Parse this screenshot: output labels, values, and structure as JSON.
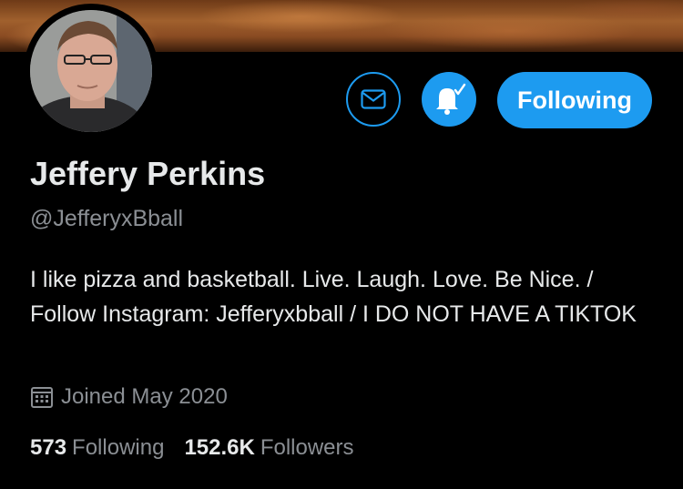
{
  "profile": {
    "name": "Jeffery Perkins",
    "handle": "@JefferyxBball",
    "bio": "I like pizza and basketball. Live. Laugh. Love. Be Nice. / Follow Instagram: Jefferyxbball / I DO NOT HAVE A TIKTOK",
    "joined": "Joined May 2020"
  },
  "actions": {
    "message_icon": "envelope-icon",
    "notify_icon": "bell-check-icon",
    "following_label": "Following"
  },
  "stats": {
    "following_count": "573",
    "following_label": "Following",
    "followers_count": "152.6K",
    "followers_label": "Followers"
  },
  "colors": {
    "accent": "#1d9bf0",
    "background": "#000000",
    "text_primary": "#e7e9ea",
    "text_secondary": "#8b8f94"
  }
}
